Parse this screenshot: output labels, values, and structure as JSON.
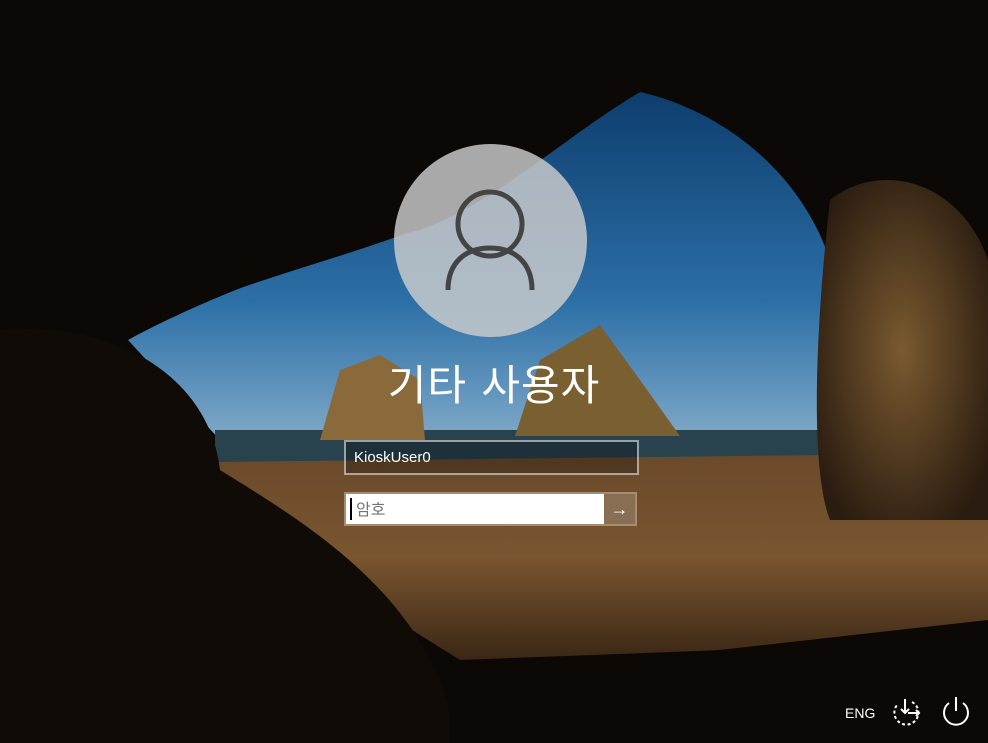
{
  "user_tile": {
    "display_name": "기타 사용자",
    "icon": "user-avatar-icon"
  },
  "username_field": {
    "value": "KioskUser0"
  },
  "password_field": {
    "value": "",
    "placeholder": "암호"
  },
  "submit_button": {
    "label": "→",
    "icon": "arrow-right-icon"
  },
  "taskbar": {
    "language": "ENG",
    "accessibility_icon": "ease-of-access-icon",
    "power_icon": "power-icon"
  }
}
